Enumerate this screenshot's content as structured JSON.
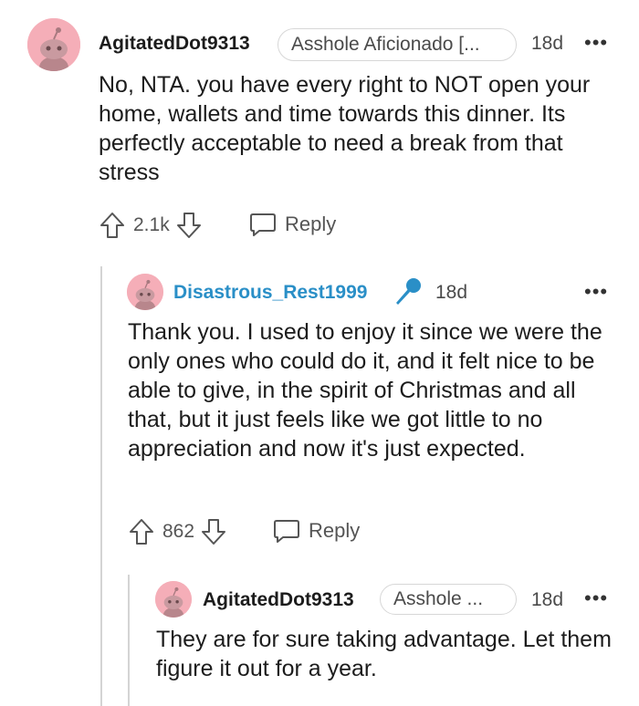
{
  "comments": [
    {
      "username": "AgitatedDot9313",
      "flair": "Asshole Aficionado [...",
      "time": "18d",
      "text": "No, NTA. you have every right to NOT open your home, wallets and time towards this dinner. Its perfectly acceptable to need a break from that stress",
      "votes": "2.1k",
      "reply_label": "Reply"
    },
    {
      "username": "Disastrous_Rest1999",
      "is_op": true,
      "time": "18d",
      "text": "Thank you. I used to enjoy it since we were the only ones who could do it, and it felt nice to be able to give, in the spirit of Christmas and all that, but it just feels like we got little to no appreciation and now it's just expected.",
      "votes": "862",
      "reply_label": "Reply"
    },
    {
      "username": "AgitatedDot9313",
      "flair": "Asshole ...",
      "time": "18d",
      "text": "They are for sure taking advantage. Let them figure it out for a year."
    }
  ],
  "icons": {
    "avatar": "snoo-avatar-icon",
    "upvote": "upvote-arrow-icon",
    "downvote": "downvote-arrow-icon",
    "reply": "speech-bubble-icon",
    "op_badge": "microphone-icon",
    "more": "more-options-icon"
  },
  "more_label": "•••",
  "colors": {
    "avatar_bg": "#f5aeb8",
    "op_username": "#2a8fc7",
    "op_mic": "#2a8fc7",
    "thread_line": "#d4d4d4"
  }
}
